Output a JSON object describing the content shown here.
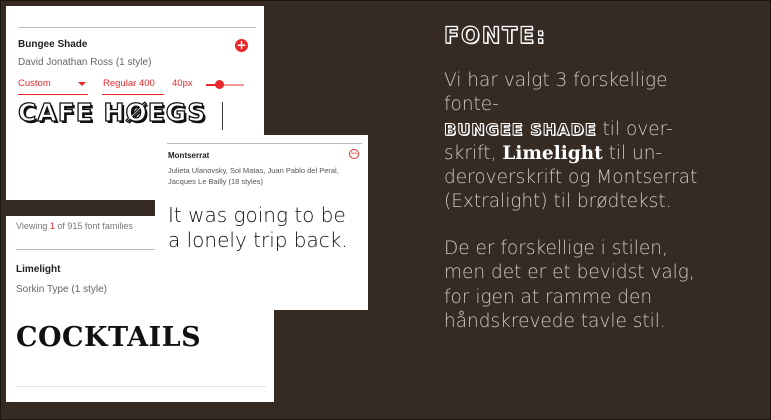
{
  "card_bungee": {
    "font_name": "Bungee Shade",
    "designer": "David Jonathan Ross (1 style)",
    "add_symbol": "+",
    "preset": "Custom",
    "weight": "Regular 400",
    "size": "40px",
    "size_slider_fraction": 0.3,
    "sample_text": "CAFE HØEGS"
  },
  "card_montserrat": {
    "font_name": "Montserrat",
    "designers": "Julieta Ulanovsky, Sol Matas, Juan Pablo del Peral, Jacques Le Bailly (18 styles)",
    "remove_symbol": "−",
    "sample_text": "It was going to be a lonely trip back."
  },
  "card_limelight": {
    "viewing_prefix": "Viewing ",
    "viewing_count": "1",
    "viewing_suffix": " of 915 font families",
    "font_name": "Limelight",
    "designer": "Sorkin Type (1 style)",
    "sample_text": "COCKTAILS"
  },
  "right": {
    "heading": "FONTE:",
    "p1_line1": "Vi har valgt 3 forskellige",
    "p1_line2": "fonte-",
    "p1_bungee": "BUNGEE SHADE",
    "p1_after_bungee": " til over-",
    "p1_line4_pre": "skrift, ",
    "p1_limelight": "Limelight",
    "p1_line4_post": " til un-",
    "p1_line5": "deroverskrift og Montserrat",
    "p1_line6": "(Extralight) til brødtekst.",
    "p2_line1": "De er forskellige i stilen,",
    "p2_line2": "men det er et bevidst valg,",
    "p2_line3": "for igen at ramme den",
    "p2_line4": "håndskrevede tavle stil."
  },
  "colors": {
    "background": "#352b23",
    "accent_red": "#e8282b",
    "body_text": "#cfc7be"
  }
}
